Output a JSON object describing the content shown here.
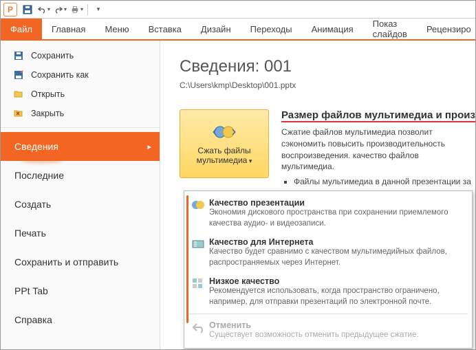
{
  "app": {
    "letter": "P"
  },
  "ribbon": {
    "tabs": [
      "Файл",
      "Главная",
      "Меню",
      "Вставка",
      "Дизайн",
      "Переходы",
      "Анимация",
      "Показ слайдов",
      "Рецензиро"
    ]
  },
  "nav": {
    "save": "Сохранить",
    "saveAs": "Сохранить как",
    "open": "Открыть",
    "close": "Закрыть",
    "info": "Сведения",
    "recent": "Последние",
    "new": "Создать",
    "print": "Печать",
    "share": "Сохранить и отправить",
    "ppttab": "PPt Tab",
    "help": "Справка"
  },
  "info": {
    "title": "Сведения: 001",
    "path": "C:\\Users\\kmp\\Desktop\\001.pptx",
    "section": {
      "heading": "Размер файлов мультимедиа и производ",
      "desc": "Сжатие файлов мультимедиа позволит сэкономить повысить производительность воспроизведения. качество файлов мультимедиа.",
      "bullet": "Файлы мультимедиа в данной презентации за"
    },
    "button": "Сжать файлы мультимедиа"
  },
  "menu": {
    "q1": {
      "t": "Качество презентации",
      "d": "Экономия дискового пространства при сохранении приемлемого качества аудио- и видеозаписи."
    },
    "q2": {
      "t": "Качество для Интернета",
      "d": "Качество будет сравнимо с качеством мультимедийных файлов, распространяемых через Интернет."
    },
    "q3": {
      "t": "Низкое качество",
      "d": "Рекомендуется использовать, когда пространство ограничено, например, для отправки презентаций по электронной почте."
    },
    "undo": {
      "t": "Отменить",
      "d": "Существует возможность отменить предыдущее сжатие."
    }
  }
}
